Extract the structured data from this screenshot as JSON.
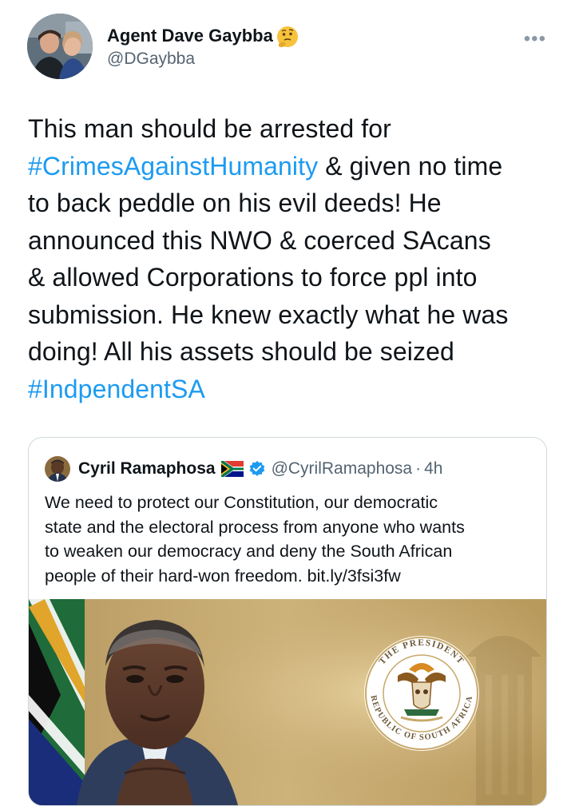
{
  "tweet": {
    "author_name": "Agent Dave Gaybba",
    "author_emoji": "thinking-face-emoji",
    "handle": "@DGaybba",
    "more_icon": "more-options-icon",
    "text_lines": [
      [
        "This man should be arrested for"
      ],
      [
        "#CrimesAgainstHumanity",
        " & given no time"
      ],
      [
        "to back peddle on his evil deeds! He"
      ],
      [
        "announced this NWO & coerced SAcans"
      ],
      [
        "& allowed Corporations to force ppl into"
      ],
      [
        "submission. He knew exactly what he was"
      ],
      [
        "doing! All his assets should be seized"
      ],
      [
        "#IndpendentSA"
      ]
    ]
  },
  "quoted_tweet": {
    "author_name": "Cyril Ramaphosa",
    "flag_icon": "south-africa-flag-icon",
    "verified_icon": "verified-badge-icon",
    "handle": "@CyrilRamaphosa",
    "separator": "·",
    "time": "4h",
    "text_lines": [
      "We need to protect our Constitution, our democratic",
      "state and the electoral process from anyone who wants",
      "to weaken our democracy and deny the South African",
      "people of their hard-won freedom. bit.ly/3fsi3fw"
    ],
    "seal_top": "THE PRESIDENT",
    "seal_bottom": "REPUBLIC OF SOUTH AFRICA"
  },
  "colors": {
    "link": "#1d9bf0",
    "text": "#0f1419",
    "secondary": "#536471",
    "verified": "#1d9bf0",
    "image_gold": "#c8a96a"
  }
}
